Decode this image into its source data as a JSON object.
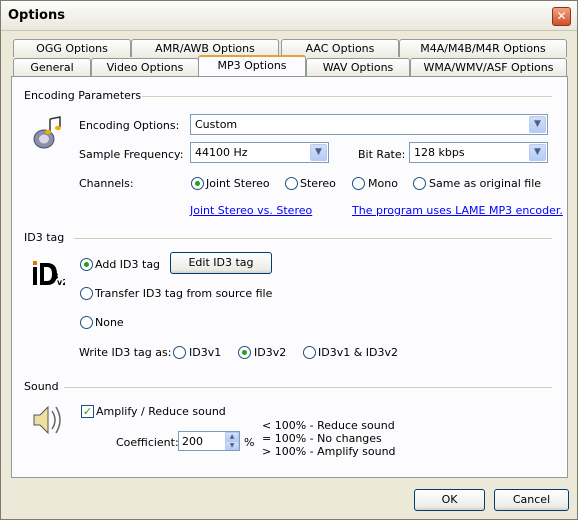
{
  "window": {
    "title": "Options"
  },
  "tabs_row1": [
    "OGG Options",
    "AMR/AWB Options",
    "AAC Options",
    "M4A/M4B/M4R Options"
  ],
  "tabs_row2": [
    "General",
    "Video Options",
    "MP3 Options",
    "WAV Options",
    "WMA/WMV/ASF Options"
  ],
  "active_tab": "MP3 Options",
  "encoding": {
    "group_title": "Encoding Parameters",
    "encoding_options_label": "Encoding Options:",
    "encoding_options_value": "Custom",
    "sample_frequency_label": "Sample Frequency:",
    "sample_frequency_value": "44100 Hz",
    "bit_rate_label": "Bit Rate:",
    "bit_rate_value": "128 kbps",
    "channels_label": "Channels:",
    "channels": [
      "Joint Stereo",
      "Stereo",
      "Mono",
      "Same as original file"
    ],
    "channels_selected": "Joint Stereo",
    "link_joint": "Joint Stereo vs. Stereo",
    "link_lame": "The program uses LAME MP3 encoder."
  },
  "id3": {
    "group_title": "ID3 tag",
    "icon_text": "iD3v2",
    "add_label": "Add ID3 tag",
    "edit_button": "Edit ID3 tag",
    "transfer_label": "Transfer ID3 tag from source file",
    "none_label": "None",
    "write_label": "Write ID3 tag as:",
    "versions": [
      "ID3v1",
      "ID3v2",
      "ID3v1 & ID3v2"
    ],
    "version_selected": "ID3v2"
  },
  "sound": {
    "group_title": "Sound",
    "amplify_label": "Amplify / Reduce sound",
    "amplify_checked": true,
    "coefficient_label": "Coefficient:",
    "coefficient_value": "200",
    "unit": "%",
    "note1": "< 100% - Reduce sound",
    "note2": "= 100% - No changes",
    "note3": "> 100% - Amplify sound"
  },
  "buttons": {
    "ok": "OK",
    "cancel": "Cancel"
  }
}
